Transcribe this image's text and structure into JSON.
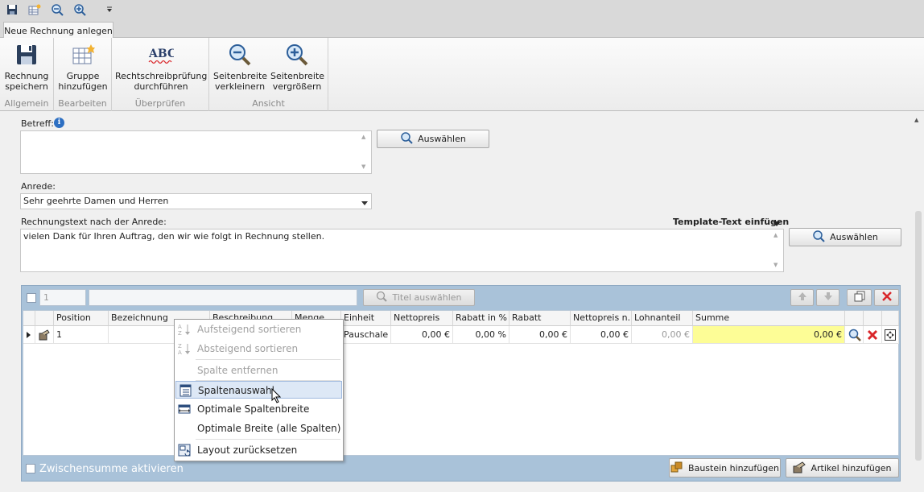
{
  "ribbon": {
    "tab": "Neue Rechnung anlegen",
    "groups": [
      {
        "label": "Allgemein",
        "buttons": [
          {
            "line1": "Rechnung",
            "line2": "speichern"
          }
        ]
      },
      {
        "label": "Bearbeiten",
        "buttons": [
          {
            "line1": "Gruppe",
            "line2": "hinzufügen"
          }
        ]
      },
      {
        "label": "Überprüfen",
        "buttons": [
          {
            "line1": "Rechtschreibprüfung",
            "line2": "durchführen"
          }
        ]
      },
      {
        "label": "Ansicht",
        "buttons": [
          {
            "line1": "Seitenbreite",
            "line2": "verkleinern"
          },
          {
            "line1": "Seitenbreite",
            "line2": "vergrößern"
          }
        ]
      }
    ],
    "abc": "ABC"
  },
  "form": {
    "betreff_label": "Betreff:",
    "betreff_value": "",
    "auswaehlen": "Auswählen",
    "anrede_label": "Anrede:",
    "anrede_value": "Sehr geehrte Damen und Herren",
    "text_label": "Rechnungstext nach der Anrede:",
    "template_label": "Template-Text einfügen",
    "text_value": "vielen Dank für Ihren Auftrag, den wir wie folgt in Rechnung stellen."
  },
  "grid": {
    "group_number": "1",
    "title_button": "Titel auswählen",
    "headers": [
      "Position",
      "Bezeichnung",
      "Beschreibung",
      "Menge",
      "Einheit",
      "Nettopreis",
      "Rabatt in %",
      "Rabatt",
      "Nettopreis n...",
      "Lohnanteil",
      "Summe"
    ],
    "row": {
      "position": "1",
      "einheit": "Pauschale",
      "nettopreis": "0,00 €",
      "rabatt_pct": "0,00 %",
      "rabatt": "0,00 €",
      "nettopreis_n": "0,00 €",
      "lohnanteil": "0,00 €",
      "summe": "0,00 €"
    },
    "zwischensumme": "Zwischensumme aktivieren",
    "baustein_button": "Baustein hinzufügen",
    "artikel_button": "Artikel hinzufügen"
  },
  "context_menu": {
    "items": [
      {
        "label": "Aufsteigend sortieren",
        "icon": "sort-ascending-icon",
        "enabled": false
      },
      {
        "label": "Absteigend sortieren",
        "icon": "sort-descending-icon",
        "enabled": false
      },
      {
        "label": "Spalte entfernen",
        "icon": "",
        "enabled": false
      },
      {
        "label": "Spaltenauswahl",
        "icon": "column-chooser-icon",
        "enabled": true,
        "highlighted": true
      },
      {
        "label": "Optimale Spaltenbreite",
        "icon": "best-fit-icon",
        "enabled": true
      },
      {
        "label": "Optimale Breite (alle Spalten)",
        "icon": "",
        "enabled": true
      },
      {
        "label": "Layout zurücksetzen",
        "icon": "reset-layout-icon",
        "enabled": true
      }
    ]
  },
  "colors": {
    "summe_bg": "#fdfd96",
    "delete_red": "#d9262a",
    "panel_blue": "#a9c2d9"
  }
}
